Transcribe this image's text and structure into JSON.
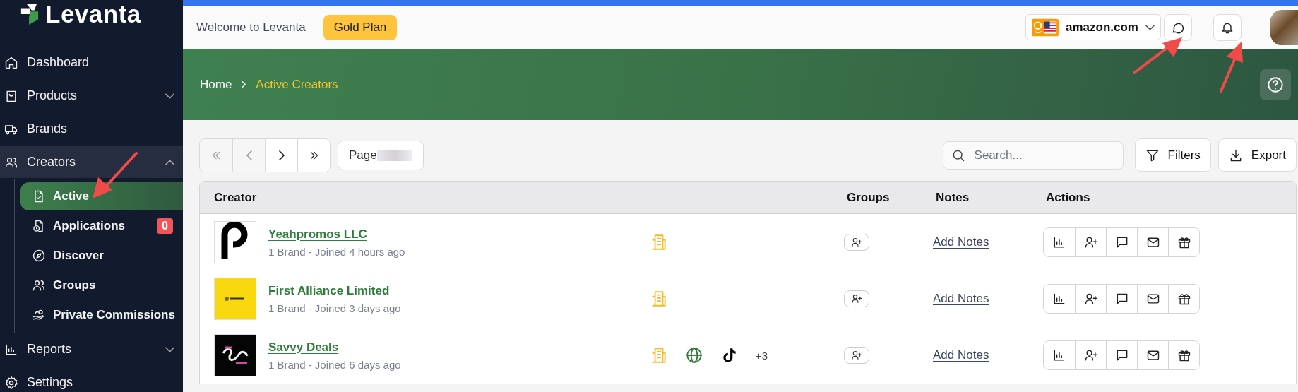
{
  "sidebar": {
    "logo": "Levanta",
    "items": [
      {
        "label": "Dashboard",
        "kind": "link",
        "selected": false
      },
      {
        "label": "Products",
        "kind": "group",
        "expanded": false,
        "selected": false
      },
      {
        "label": "Brands",
        "kind": "link",
        "selected": false
      },
      {
        "label": "Creators",
        "kind": "group",
        "expanded": true,
        "selected": false,
        "children": [
          {
            "label": "Active",
            "selected": true
          },
          {
            "label": "Applications",
            "selected": false,
            "badge": "0"
          },
          {
            "label": "Discover",
            "selected": false
          },
          {
            "label": "Groups",
            "selected": false
          },
          {
            "label": "Private Commissions",
            "selected": false
          }
        ]
      },
      {
        "label": "Reports",
        "kind": "group",
        "expanded": false,
        "selected": false
      },
      {
        "label": "Settings",
        "kind": "link",
        "selected": false
      }
    ]
  },
  "header": {
    "welcome": "Welcome to Levanta",
    "plan": "Gold Plan",
    "marketplace": "amazon.com"
  },
  "breadcrumb": [
    {
      "label": "Home",
      "selected": false
    },
    {
      "label": "Active Creators",
      "selected": true
    }
  ],
  "pagination": {
    "buttons": [
      {
        "kind": "first",
        "disabled": true
      },
      {
        "kind": "prev",
        "disabled": true
      },
      {
        "kind": "next",
        "disabled": false
      },
      {
        "kind": "last",
        "disabled": false
      }
    ],
    "page_label": "Page"
  },
  "search": {
    "placeholder": "Search..."
  },
  "buttons": [
    {
      "kind": "filter",
      "label": "Filters"
    },
    {
      "kind": "export",
      "label": "Export"
    }
  ],
  "table": {
    "columns": [
      "Creator",
      "Groups",
      "Notes",
      "Actions"
    ],
    "rows": [
      {
        "name": "Yeahpromos LLC",
        "meta": "1 Brand - Joined 4 hours ago",
        "socials": [
          {
            "kind": "brand"
          }
        ],
        "notes": "Add Notes"
      },
      {
        "name": "First Alliance Limited",
        "meta": "1 Brand - Joined 3 days ago",
        "socials": [
          {
            "kind": "brand"
          }
        ],
        "notes": "Add Notes"
      },
      {
        "name": "Savvy Deals",
        "meta": "1 Brand - Joined 6 days ago",
        "socials": [
          {
            "kind": "brand"
          },
          {
            "kind": "website"
          },
          {
            "kind": "tiktok"
          }
        ],
        "more": "+3",
        "notes": "Add Notes"
      }
    ]
  }
}
